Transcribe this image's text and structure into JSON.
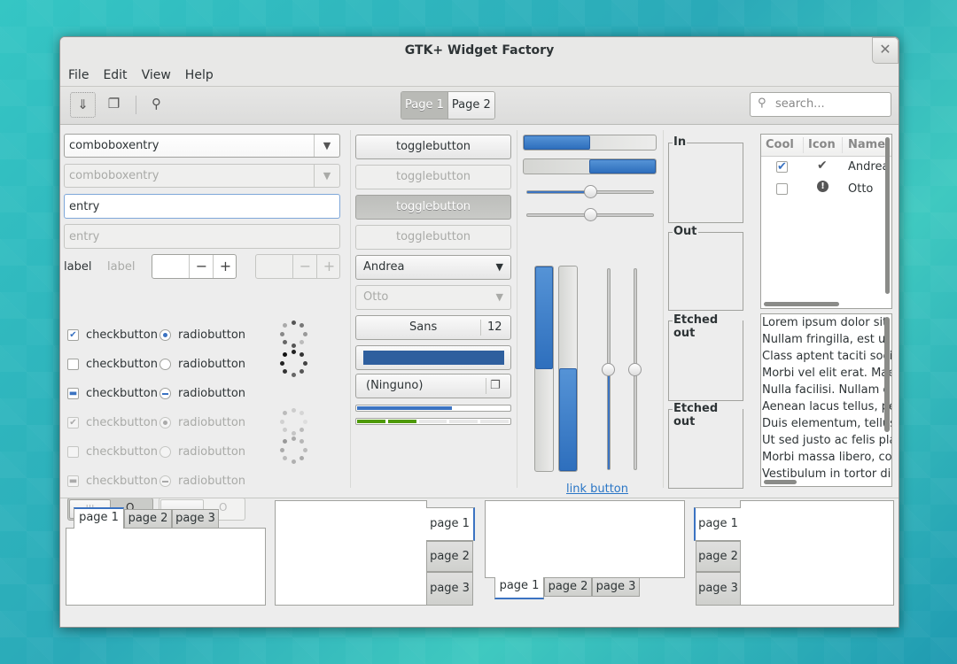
{
  "window": {
    "title": "GTK+ Widget Factory"
  },
  "menubar": {
    "items": [
      "File",
      "Edit",
      "View",
      "Help"
    ]
  },
  "toolbar": {
    "pages": [
      "Page 1",
      "Page 2"
    ],
    "search_placeholder": "search..."
  },
  "col1": {
    "combo1": "comboboxentry",
    "combo2": "comboboxentry",
    "entry1": "entry",
    "entry2": "entry",
    "label1": "label",
    "label2": "label",
    "check": "checkbutton",
    "radio": "radiobutton",
    "switch_on_mark": "III",
    "switch_off_mark": "O"
  },
  "col2": {
    "toggle": "togglebutton",
    "combo_andrea": "Andrea",
    "combo_otto": "Otto",
    "font_name": "Sans",
    "font_size": "12",
    "color_hex": "#2e5f9e",
    "file_chooser": "(Ninguno)",
    "progress1": 0.62,
    "progress2_parts": 5
  },
  "col3": {
    "progress_top": 0.5,
    "progress_second": 0.5,
    "hscale1": 0.5,
    "hscale2": 0.5,
    "vprog1": 0.5,
    "vprog2": 0.5,
    "vscale1": 0.5,
    "vscale2": 0.5,
    "link": "link button",
    "expander": "expander"
  },
  "frames": [
    "In",
    "Out",
    "Etched out",
    "Etched out"
  ],
  "tree": {
    "headers": [
      "Cool",
      "Icon",
      "Name"
    ],
    "rows": [
      {
        "name": "Andrea",
        "cool": true,
        "icon": "check-circle-icon"
      },
      {
        "name": "Otto",
        "cool": false,
        "icon": "warning-circle-icon"
      }
    ]
  },
  "textview": {
    "lines": [
      "Lorem ipsum dolor sit",
      "Nullam fringilla, est ut",
      "Class aptent taciti soci",
      "Morbi vel elit erat. Mae",
      "Nulla facilisi. Nullam e",
      "Aenean lacus tellus, pe",
      "Duis elementum, tellus",
      "Ut sed justo ac felis pla",
      "Morbi massa libero, co",
      "Vestibulum in tortor di"
    ]
  },
  "notebooks": {
    "tabs": [
      "page 1",
      "page 2",
      "page 3"
    ]
  },
  "colors": {
    "accent": "#3b73c2",
    "progress_green": "#4e9a06"
  }
}
